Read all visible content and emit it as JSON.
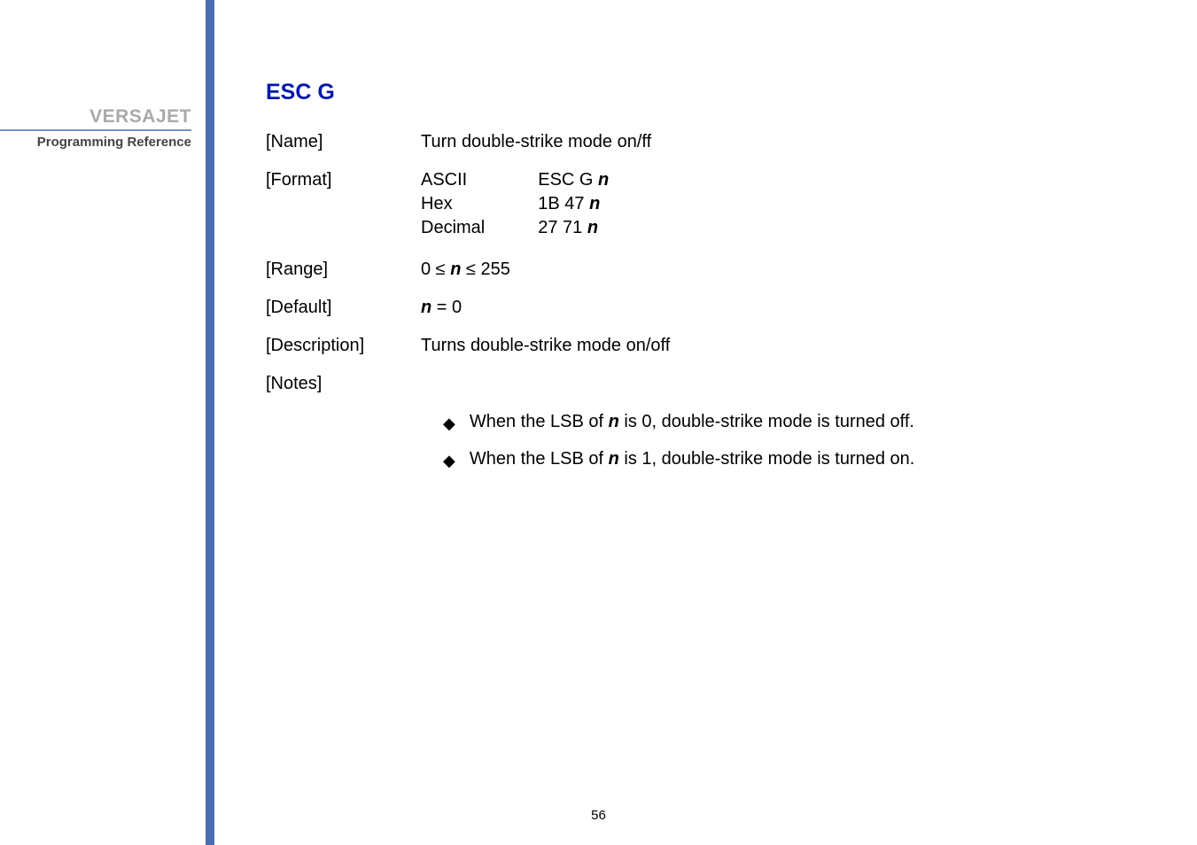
{
  "sidebar": {
    "brand": "VERSAJET",
    "subtitle": "Programming Reference"
  },
  "content": {
    "command_title": "ESC G",
    "rows": {
      "name_label": "[Name]",
      "name_value": "Turn double-strike mode on/ff",
      "format_label": "[Format]",
      "format": {
        "ascii_label": "ASCII",
        "ascii_value_prefix": "ESC G ",
        "ascii_param": "n",
        "hex_label": "Hex",
        "hex_value_prefix": "1B 47 ",
        "hex_param": "n",
        "decimal_label": "Decimal",
        "decimal_value_prefix": "27 71 ",
        "decimal_param": "n"
      },
      "range_label": "[Range]",
      "range_prefix": "0 ≤ ",
      "range_param": "n",
      "range_suffix": " ≤ 255",
      "default_label": "[Default]",
      "default_param": "n",
      "default_suffix": " = 0",
      "description_label": "[Description]",
      "description_value": "Turns double-strike mode on/off",
      "notes_label": "[Notes]"
    },
    "notes": [
      {
        "prefix": "When the LSB of ",
        "param": "n",
        "suffix": " is 0, double-strike mode is turned off."
      },
      {
        "prefix": "When the LSB of ",
        "param": "n",
        "suffix": " is 1, double-strike mode is turned on."
      }
    ]
  },
  "page_number": "56"
}
